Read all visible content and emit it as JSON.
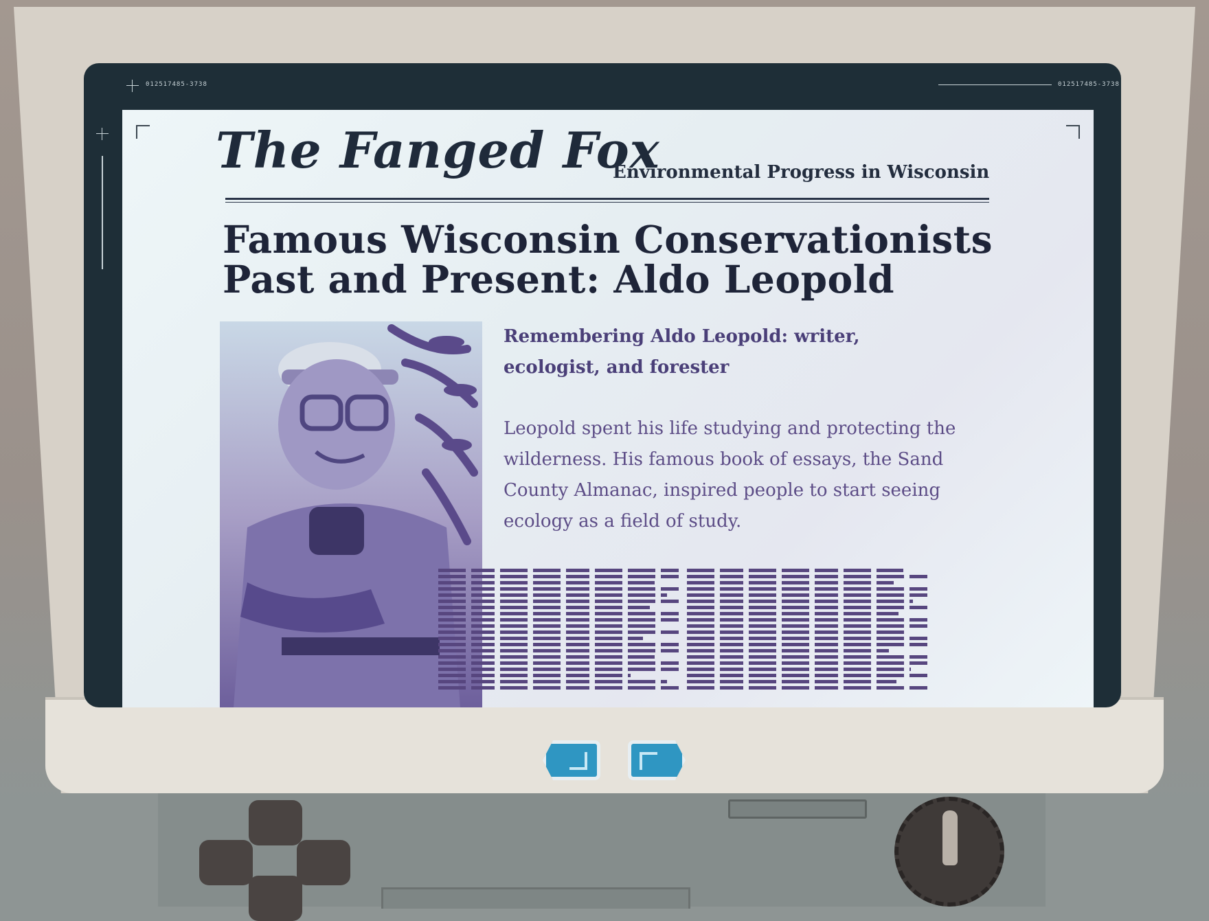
{
  "hud": {
    "code_left": "012517485-3738",
    "code_right": "012517485-3738"
  },
  "newspaper": {
    "masthead": "The Fanged Fox",
    "tagline": "Environmental Progress in Wisconsin",
    "headline_line1": "Famous Wisconsin Conservationists",
    "headline_line2": "Past and Present: Aldo Leopold",
    "subhead": "Remembering Aldo Leopold: writer, ecologist, and forester",
    "body": "Leopold spent his life studying and protecting the wilderness. His famous book of essays, the Sand County Almanac, inspired people to start seeing ecology as a field of study."
  },
  "navigation": {
    "prev_icon": "arrow-left-icon",
    "next_icon": "arrow-right-icon",
    "button_color": "#2f96c2"
  },
  "colors": {
    "screen_frame": "#1e2e37",
    "ink_dark": "#1e2438",
    "ink_purple": "#5c4c86"
  }
}
